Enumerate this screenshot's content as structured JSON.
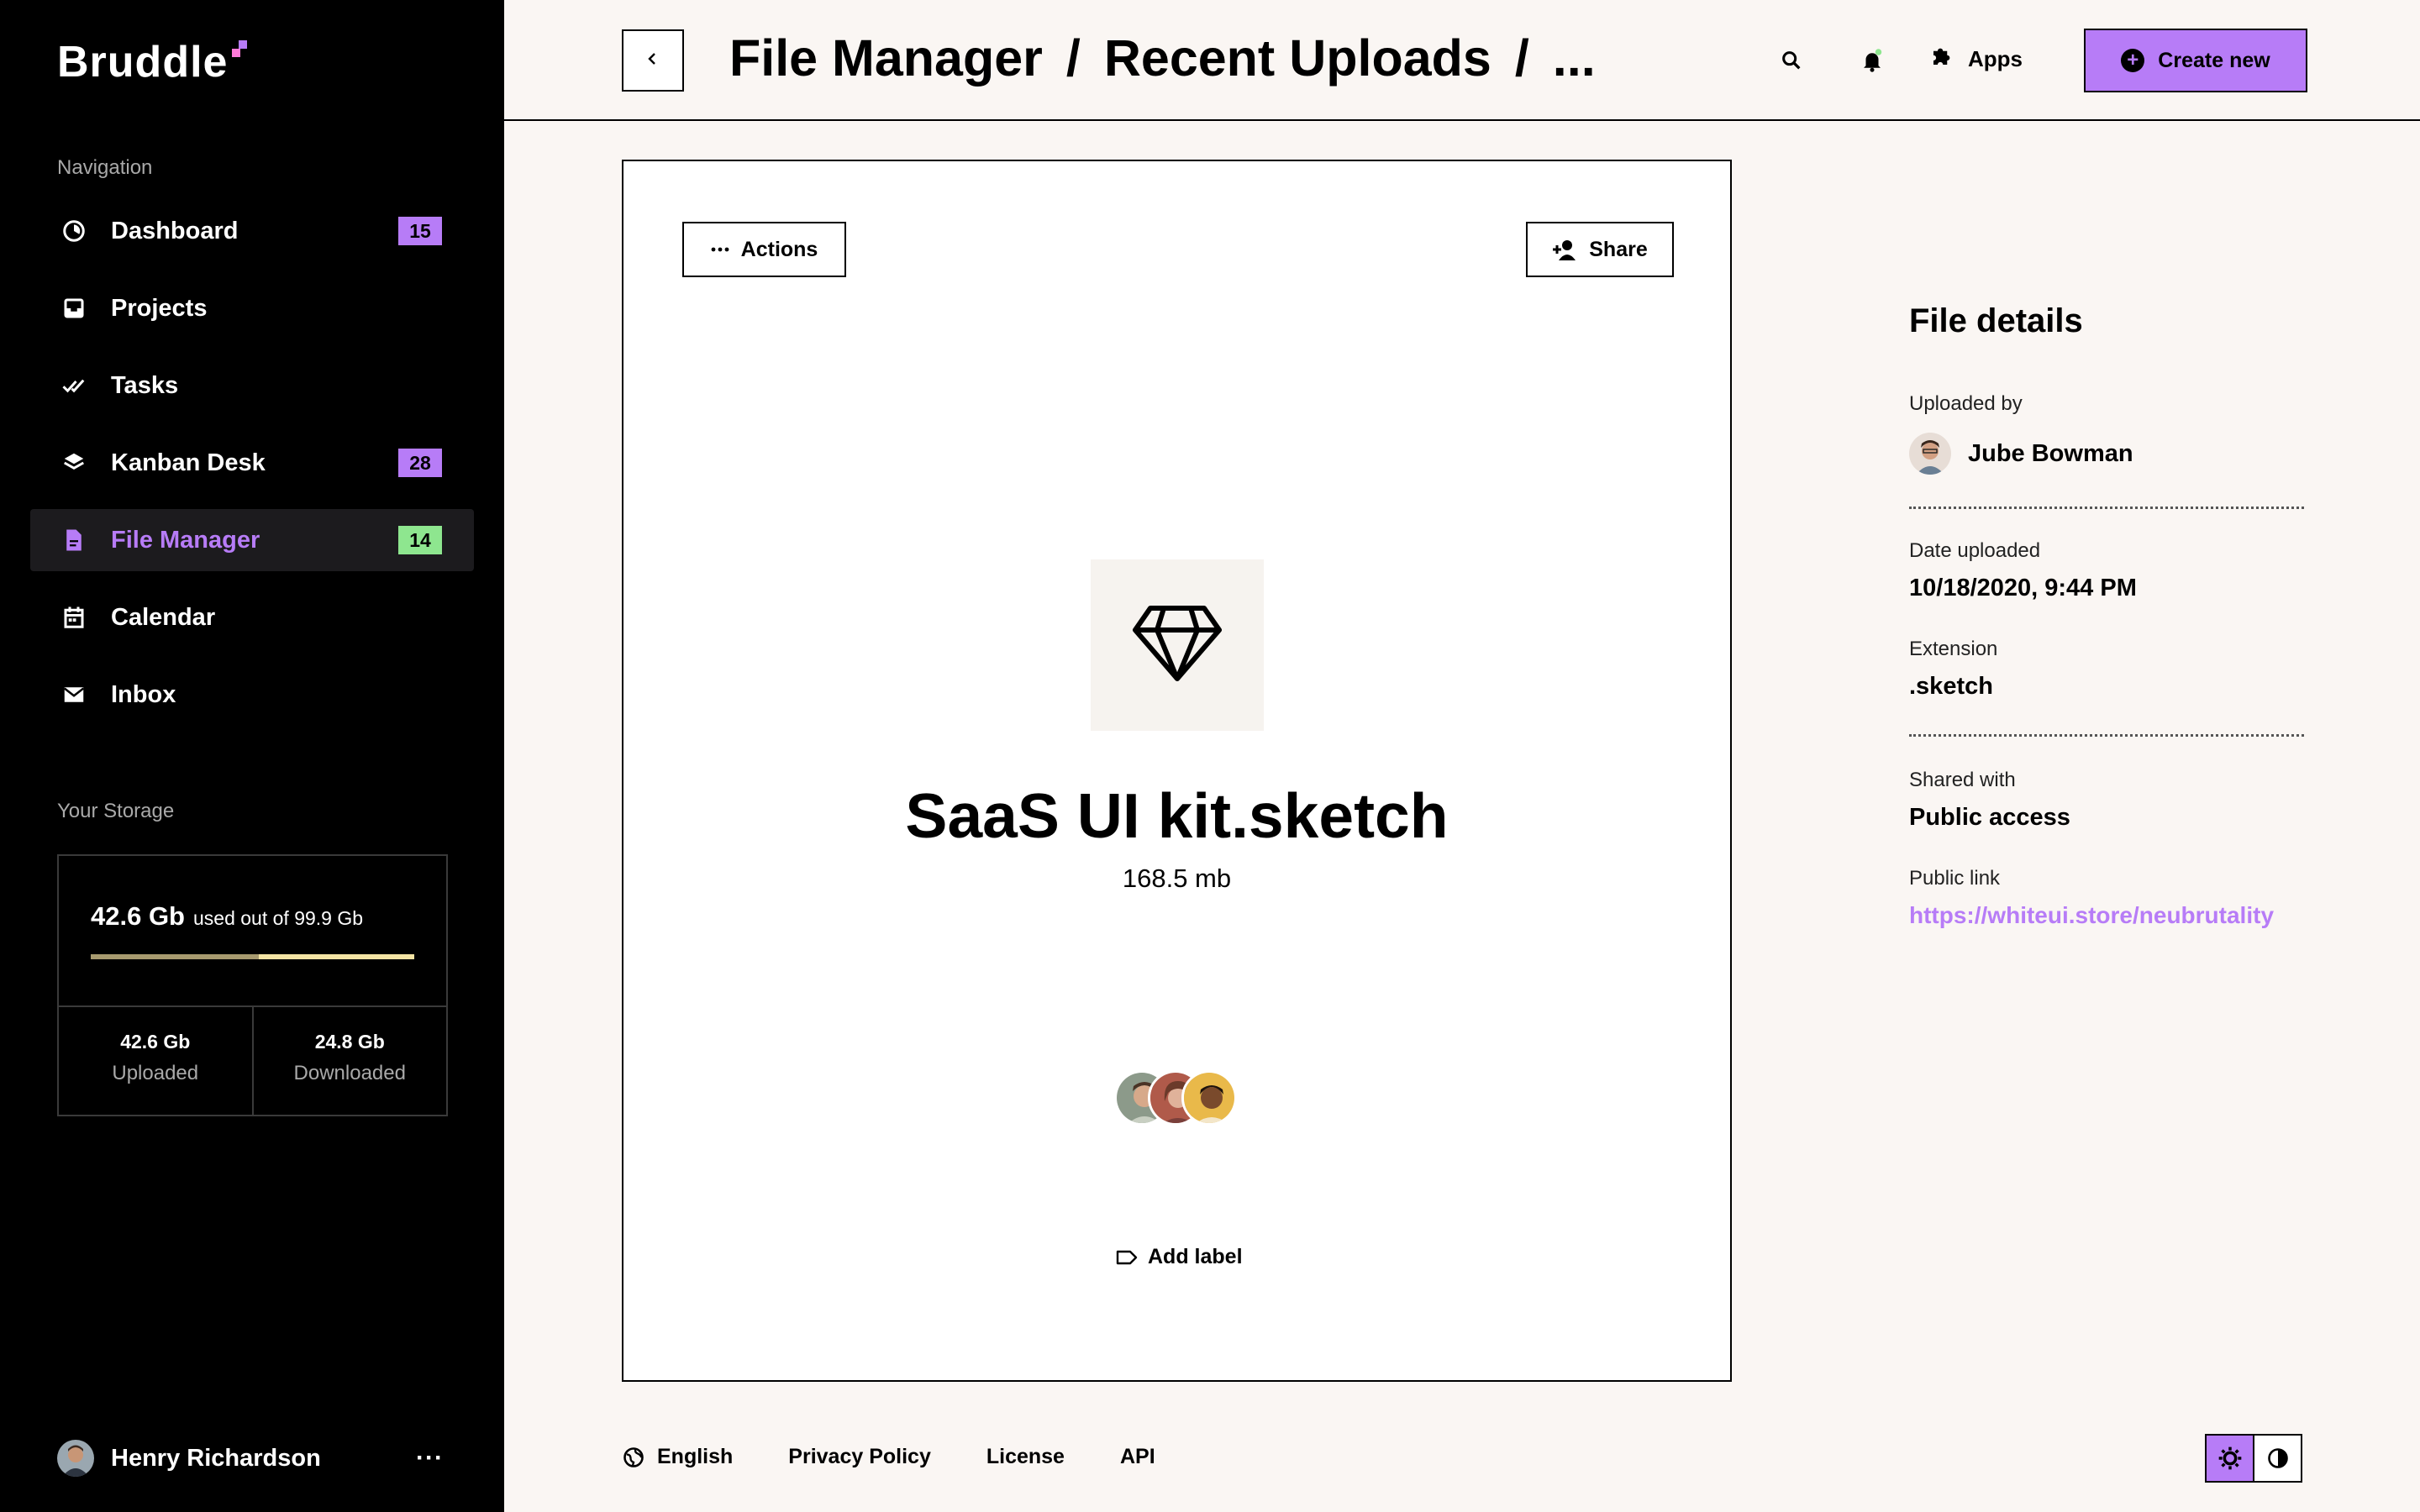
{
  "app": {
    "logo": "Bruddle",
    "accent": "#b77cf7",
    "badge_green": "#8ee68f"
  },
  "sidebar": {
    "nav_title": "Navigation",
    "items": [
      {
        "label": "Dashboard",
        "icon": "dashboard-icon",
        "badge": "15"
      },
      {
        "label": "Projects",
        "icon": "projects-icon",
        "badge": ""
      },
      {
        "label": "Tasks",
        "icon": "tasks-icon",
        "badge": ""
      },
      {
        "label": "Kanban Desk",
        "icon": "kanban-icon",
        "badge": "28"
      },
      {
        "label": "File Manager",
        "icon": "file-icon",
        "badge": "14",
        "active": true
      },
      {
        "label": "Calendar",
        "icon": "calendar-icon",
        "badge": ""
      },
      {
        "label": "Inbox",
        "icon": "inbox-icon",
        "badge": ""
      }
    ],
    "storage_title": "Your Storage",
    "storage": {
      "used": "42.6 Gb",
      "used_suffix": "used out of 99.9 Gb",
      "used_fraction": 0.52,
      "uploaded_value": "42.6 Gb",
      "uploaded_label": "Uploaded",
      "downloaded_value": "24.8 Gb",
      "downloaded_label": "Downloaded"
    },
    "user": {
      "name": "Henry Richardson",
      "more": "···"
    }
  },
  "header": {
    "breadcrumb": [
      "File Manager",
      "Recent Uploads",
      "..."
    ],
    "separator": "/",
    "apps_label": "Apps",
    "create_label": "Create new"
  },
  "card": {
    "actions_label": "Actions",
    "share_label": "Share",
    "file_name": "SaaS UI kit.sketch",
    "file_size": "168.5 mb",
    "add_label": "Add label"
  },
  "details": {
    "title": "File details",
    "uploaded_by_label": "Uploaded by",
    "uploaded_by": "Jube Bowman",
    "date_label": "Date uploaded",
    "date": "10/18/2020, 9:44 PM",
    "extension_label": "Extension",
    "extension": ".sketch",
    "shared_label": "Shared with",
    "shared": "Public access",
    "link_label": "Public link",
    "link": "https://whiteui.store/neubrutality"
  },
  "footer": {
    "language": "English",
    "privacy": "Privacy Policy",
    "license": "License",
    "api": "API"
  }
}
